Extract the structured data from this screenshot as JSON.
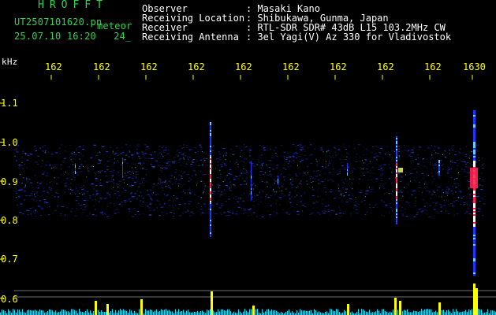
{
  "header": {
    "brand": "HROFFT",
    "file_name": "UT2507101620.pn",
    "file_tag": "meteor",
    "datetime": "25.07.10 16:20",
    "datetime_extra": "24_",
    "fields": [
      {
        "key": "Observer",
        "value": ": Masaki Kano"
      },
      {
        "key": "Receiving Location",
        "value": ": Shibukawa, Gunma, Japan"
      },
      {
        "key": "Receiver",
        "value": ": RTL-SDR SDR# 43dB L15 103.2MHz CW"
      },
      {
        "key": "Receiving Antenna",
        "value": ": 3el Yagi(V) Az 330 for Vladivostok"
      }
    ]
  },
  "axes": {
    "y_unit": "kHz",
    "y_ticks": [
      "1.1",
      "1.0",
      "0.9",
      "0.8",
      "0.7",
      "0.6"
    ],
    "x_ticks": [
      "162",
      "162",
      "162",
      "162",
      "162",
      "162",
      "162",
      "162",
      "162",
      "1630"
    ]
  },
  "colors": {
    "text_green": "#2bd84a",
    "text_white": "#ffffff",
    "tick_yellow": "#ffff00",
    "signal_blue": "#2233ff",
    "signal_red": "#ff2255",
    "baseline_cyan": "#00e5ff"
  }
}
